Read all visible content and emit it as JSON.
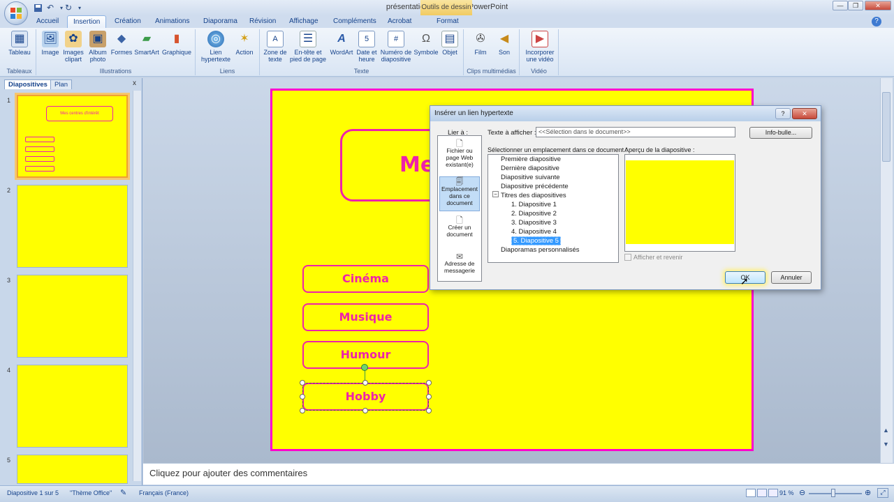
{
  "window": {
    "title": "présentation - Microsoft PowerPoint",
    "context_tab": "Outils de dessin",
    "controls": [
      "—",
      "❐",
      "✕"
    ]
  },
  "tabs": [
    "Accueil",
    "Insertion",
    "Création",
    "Animations",
    "Diaporama",
    "Révision",
    "Affichage",
    "Compléments",
    "Acrobat",
    "Format"
  ],
  "active_tab": "Insertion",
  "ribbon": {
    "groups": [
      {
        "label": "Tableaux",
        "buttons": [
          "Tableau"
        ]
      },
      {
        "label": "Illustrations",
        "buttons": [
          "Image",
          "Images clipart",
          "Album photo",
          "Formes",
          "SmartArt",
          "Graphique"
        ]
      },
      {
        "label": "Liens",
        "buttons": [
          "Lien hypertexte",
          "Action"
        ]
      },
      {
        "label": "Texte",
        "buttons": [
          "Zone de texte",
          "En-tête et pied de page",
          "WordArt",
          "Date et heure",
          "Numéro de diapositive",
          "Symbole",
          "Objet"
        ]
      },
      {
        "label": "Clips multimédias",
        "buttons": [
          "Film",
          "Son"
        ]
      },
      {
        "label": "Vidéo",
        "buttons": [
          "Incorporer une vidéo"
        ]
      }
    ]
  },
  "panel": {
    "tabs": [
      "Diapositives",
      "Plan"
    ],
    "close": "x",
    "slides": [
      "1",
      "2",
      "3",
      "4",
      "5"
    ],
    "thumb1_title": "Mes centres d'intérêt"
  },
  "slide": {
    "title_partial": "Mes",
    "buttons": [
      "Cinéma",
      "Musique",
      "Humour",
      "Hobby"
    ]
  },
  "notes_placeholder": "Cliquez pour ajouter des commentaires",
  "status": {
    "slide_info": "Diapositive 1 sur 5",
    "theme": "\"Thème Office\"",
    "language": "Français (France)",
    "zoom": "91 %"
  },
  "dialog": {
    "title": "Insérer un lien hypertexte",
    "help": "?",
    "close": "✕",
    "link_to_label": "Lier à :",
    "display_text_label": "Texte à afficher :",
    "display_text_value": "<<Sélection dans le document>>",
    "tooltip_button": "Info-bulle...",
    "location_label": "Sélectionner un emplacement dans ce document :",
    "preview_label": "Aperçu de la diapositive :",
    "link_options": [
      "Fichier ou page Web existant(e)",
      "Emplacement dans ce document",
      "Créer un document",
      "Adresse de messagerie"
    ],
    "tree": {
      "first": "Première diapositive",
      "last": "Dernière diapositive",
      "next": "Diapositive suivante",
      "prev": "Diapositive précédente",
      "titles": "Titres des diapositives",
      "slides": [
        "1. Diapositive 1",
        "2. Diapositive 2",
        "3. Diapositive 3",
        "4. Diapositive 4",
        "5. Diapositive 5"
      ],
      "custom": "Diaporamas personnalisés",
      "selected": "5. Diapositive 5"
    },
    "show_and_return": "Afficher et revenir",
    "ok": "OK",
    "cancel": "Annuler"
  }
}
